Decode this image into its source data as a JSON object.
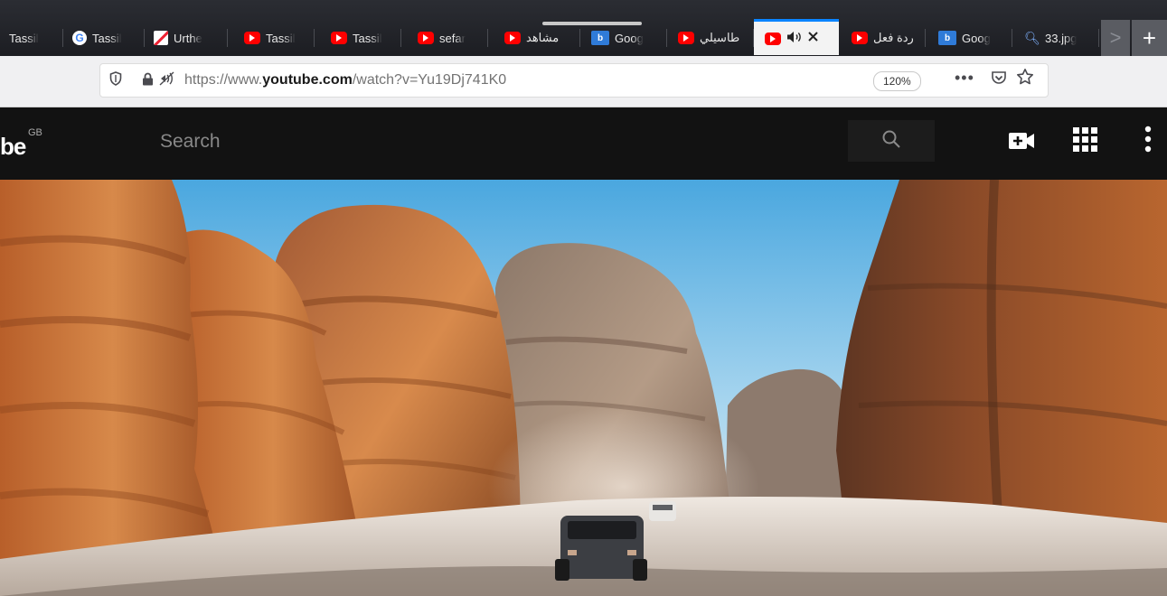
{
  "browser": {
    "tabs": [
      {
        "icon": "document-favicon-icon",
        "label": "Tassil"
      },
      {
        "icon": "google-favicon-icon",
        "label": "Tassil"
      },
      {
        "icon": "pencil-favicon-icon",
        "label": "Urthe"
      },
      {
        "icon": "youtube-favicon-icon",
        "label": "Tassil"
      },
      {
        "icon": "youtube-favicon-icon",
        "label": "Tassil"
      },
      {
        "icon": "youtube-favicon-icon",
        "label": "sefar"
      },
      {
        "icon": "youtube-favicon-icon",
        "label": "مشاهد"
      },
      {
        "icon": "bing-favicon-icon",
        "label": "Goog"
      },
      {
        "icon": "youtube-favicon-icon",
        "label": "طاسيلي"
      },
      {
        "icon": "youtube-favicon-icon",
        "label": "",
        "active": true
      },
      {
        "icon": "youtube-favicon-icon",
        "label": "ردة فعل"
      },
      {
        "icon": "bing-favicon-icon",
        "label": "Goog"
      },
      {
        "icon": "image-search-favicon-icon",
        "label": "33.jpg"
      }
    ],
    "new_tab_symbol": "+",
    "scroll_symbol": ">",
    "url": {
      "prefix": "https://www.",
      "domain": "youtube.com",
      "path": "/watch?v=Yu19Dj741K0"
    },
    "zoom": "120%",
    "more_symbol": "•••"
  },
  "youtube": {
    "logo_text": "be",
    "region": "GB",
    "search_placeholder": "Search"
  },
  "colors": {
    "accent": "#0a84ff",
    "youtube_red": "#ff0000",
    "header_bg": "#121212"
  }
}
